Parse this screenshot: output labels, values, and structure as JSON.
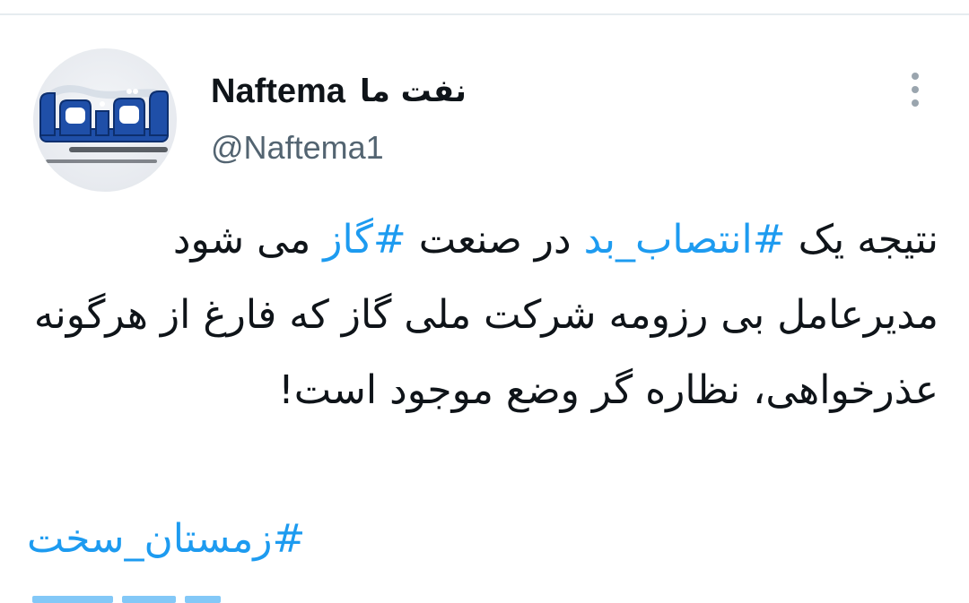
{
  "tweet": {
    "author": {
      "display_name": "Naftema",
      "display_name_fa": "نفت ما",
      "handle": "@Naftema1",
      "avatar_icon": "naftema-logo-avatar"
    },
    "menu_icon": "more-vertical-icon",
    "text_segments": [
      {
        "type": "text",
        "value": "نتیجه یک "
      },
      {
        "type": "hashtag",
        "value": "#انتصاب_بد"
      },
      {
        "type": "text",
        "value": " در صنعت "
      },
      {
        "type": "hashtag",
        "value": "#گاز"
      },
      {
        "type": "text",
        "value": " می شود مدیرعامل بی رزومه شرکت ملی گاز که فارغ از هرگونه عذرخواهی، نظاره گر وضع موجود است!"
      }
    ],
    "hashtags_line": "#زمستان_سخت"
  },
  "colors": {
    "link": "#1d9bf0",
    "text": "#0f1419",
    "secondary": "#536471"
  }
}
